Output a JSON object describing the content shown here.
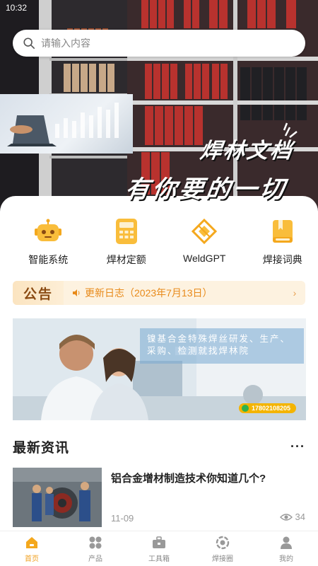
{
  "status_bar": {
    "time": "10:32"
  },
  "search": {
    "placeholder": "请输入内容"
  },
  "hero": {
    "title": "焊林文档",
    "subtitle": "有你要的一切"
  },
  "quick_actions": [
    {
      "label": "智能系统",
      "icon": "robot-icon"
    },
    {
      "label": "焊材定额",
      "icon": "calculator-icon"
    },
    {
      "label": "WeldGPT",
      "icon": "weldgpt-logo-icon"
    },
    {
      "label": "焊接词典",
      "icon": "book-icon"
    }
  ],
  "notice": {
    "tag": "公告",
    "text": "更新日志（2023年7月13日）"
  },
  "banner": {
    "caption": "镍基合金特殊焊丝研发、生产、采购、检测就找焊林院",
    "phone": "17802108205"
  },
  "news": {
    "section_title": "最新资讯",
    "items": [
      {
        "headline": "铝合金增材制造技术你知道几个?",
        "date": "11-09",
        "views": "34"
      }
    ]
  },
  "tabbar": {
    "items": [
      {
        "label": "首页",
        "icon": "home-icon",
        "active": true
      },
      {
        "label": "产品",
        "icon": "grid-icon",
        "active": false
      },
      {
        "label": "工具箱",
        "icon": "toolbox-icon",
        "active": false
      },
      {
        "label": "焊接圈",
        "icon": "circle-icon",
        "active": false
      },
      {
        "label": "我的",
        "icon": "user-icon",
        "active": false
      }
    ]
  },
  "colors": {
    "accent": "#f0a020",
    "notice_text": "#e88a1a",
    "notice_bg": "#fdf2e0"
  }
}
